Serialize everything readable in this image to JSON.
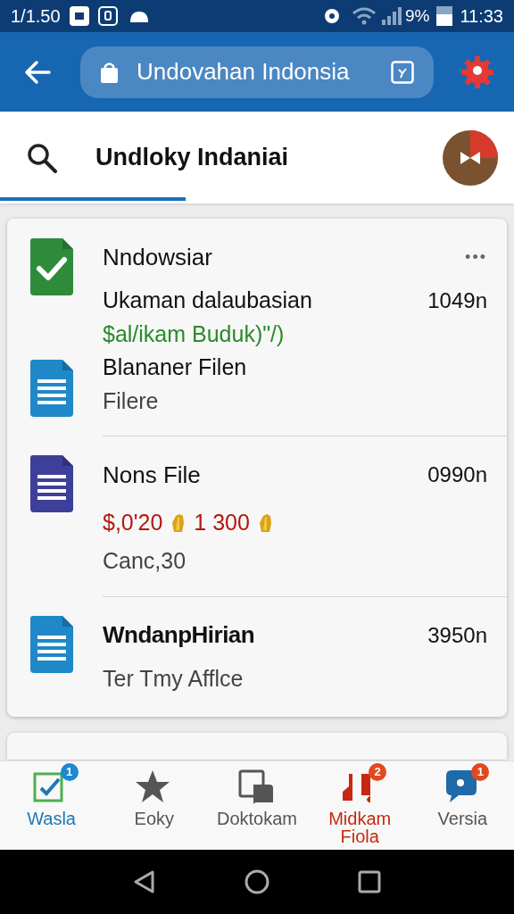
{
  "status_bar": {
    "left_text": "1/1.50",
    "battery": "9%",
    "time": "11:33"
  },
  "app_bar": {
    "search": {
      "value": "Undovahan Indonsia"
    }
  },
  "tab_bar": {
    "title": "Undloky Indaniai"
  },
  "rows": [
    {
      "icons": [
        {
          "kind": "check",
          "color": "#2e8b3a"
        },
        {
          "kind": "doc",
          "color": "#1e88c8"
        }
      ],
      "title": "Nndowsiar",
      "bold": false,
      "menu": "•••",
      "lines": [
        {
          "kind": "primary",
          "text": "Ukaman dalaubasian",
          "size": "1049n"
        },
        {
          "kind": "price",
          "text": "$al/ikam Buduk)\"/)",
          "color": "#2a8a2a"
        },
        {
          "kind": "primary",
          "text": "Blananer Filen"
        },
        {
          "kind": "meta",
          "text": "Filere"
        }
      ]
    },
    {
      "icons": [
        {
          "kind": "doc",
          "color": "#3d3f9a"
        }
      ],
      "title": "Nons File",
      "bold": false,
      "size": "0990n",
      "lines": [
        {
          "kind": "amounts",
          "values": [
            "$,0'20",
            "1 300"
          ],
          "color": "#b3170f"
        },
        {
          "kind": "meta",
          "text": "Canc,30"
        }
      ]
    },
    {
      "icons": [
        {
          "kind": "doc",
          "color": "#1e88c8"
        }
      ],
      "title": "WndanpHirian",
      "bold": true,
      "size": "3950n",
      "lines": [
        {
          "kind": "meta",
          "text": "Ter Tmy Afflce"
        }
      ]
    }
  ],
  "bottom_nav": [
    {
      "label": "Wasla",
      "kind": "check",
      "badge": "1",
      "selected": true
    },
    {
      "label": "Eoky",
      "kind": "star",
      "selected": false
    },
    {
      "label": "Doktokam",
      "kind": "chat",
      "selected": false
    },
    {
      "label": "Midkam Fiola",
      "kind": "music",
      "badge": "2",
      "selected": false,
      "color": "#c62810"
    },
    {
      "label": "Versia",
      "kind": "bubble",
      "badge": "1",
      "selected": false
    }
  ]
}
